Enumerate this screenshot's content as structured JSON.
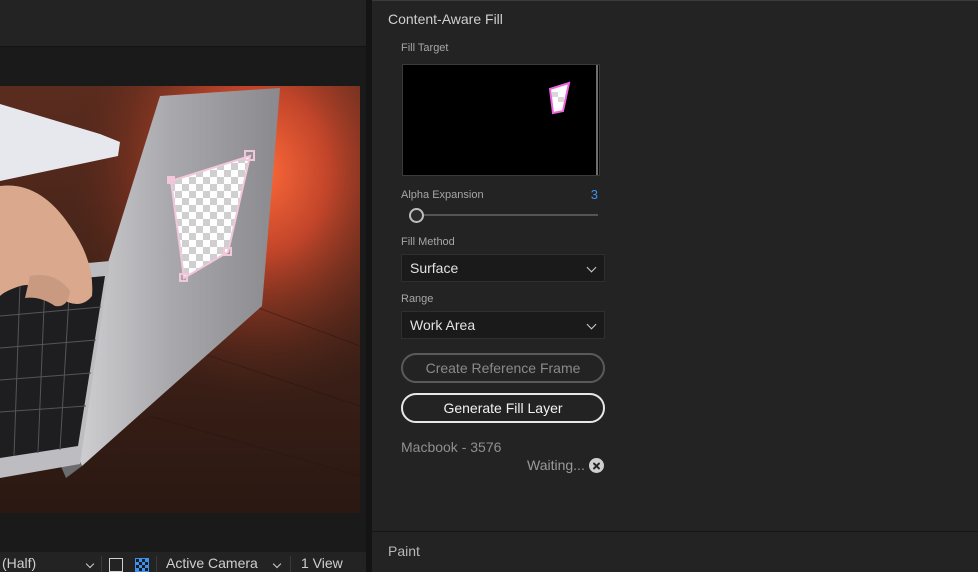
{
  "content_aware_fill": {
    "title": "Content-Aware Fill",
    "fill_target_label": "Fill Target",
    "alpha_expansion_label": "Alpha Expansion",
    "alpha_expansion_value": "3",
    "fill_method_label": "Fill Method",
    "fill_method_value": "Surface",
    "range_label": "Range",
    "range_value": "Work Area",
    "create_reference_frame_label": "Create Reference Frame",
    "generate_fill_layer_label": "Generate Fill Layer",
    "layer_name": "Macbook - 3576",
    "status_text": "Waiting..."
  },
  "paint_panel": {
    "title": "Paint"
  },
  "viewer_bar": {
    "resolution_value": "(Half)",
    "camera_value": "Active Camera",
    "view_layout_value": "1 View"
  },
  "icons": {
    "cancel": "cancel-icon",
    "transparency_grid": "transparency-grid-icon",
    "region_of_interest": "region-of-interest-icon",
    "chevron": "chevron-down-icon"
  },
  "colors": {
    "panel_bg": "#232323",
    "accent_value": "#3d92f0",
    "mask_outline": "#ee66dd"
  }
}
